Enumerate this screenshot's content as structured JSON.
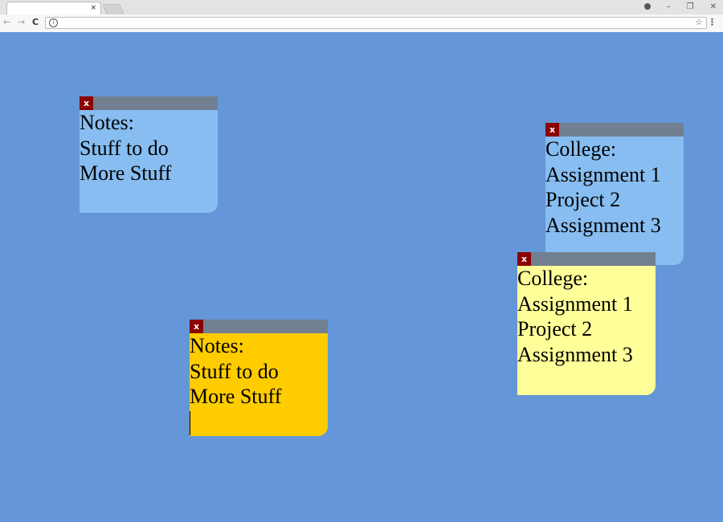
{
  "browser": {
    "tab_close": "×",
    "window": {
      "minimize": "–",
      "restore": "❐",
      "close": "✕"
    },
    "nav": {
      "back": "←",
      "forward": "→",
      "reload": "C"
    },
    "omnibox": {
      "info_glyph": "i",
      "star_glyph": "☆"
    },
    "menu_glyph": "⋮"
  },
  "notes": [
    {
      "color": "#87bdf0",
      "close_label": "x",
      "lines": [
        "Notes:",
        "Stuff to do",
        "More Stuff"
      ]
    },
    {
      "color": "#87bdf0",
      "close_label": "x",
      "lines": [
        "College:",
        "Assignment 1",
        "Project 2",
        "Assignment 3"
      ]
    },
    {
      "color": "#ffff99",
      "close_label": "x",
      "lines": [
        "College:",
        "Assignment 1",
        "Project 2",
        "Assignment 3"
      ]
    },
    {
      "color": "#ffcc00",
      "close_label": "x",
      "lines": [
        "Notes:",
        "Stuff to do",
        "More Stuff"
      ]
    }
  ],
  "colors": {
    "desktop_background": "#6596d8",
    "note_bar": "#708090",
    "note_close": "#8b0000"
  }
}
